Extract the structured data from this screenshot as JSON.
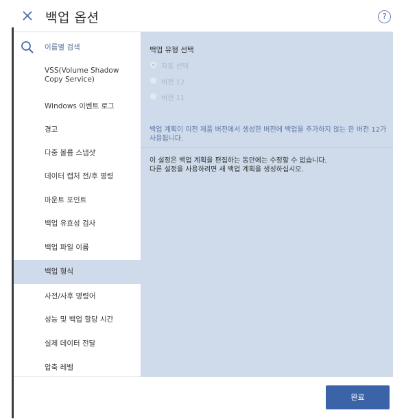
{
  "header": {
    "title": "백업 옵션",
    "help_symbol": "?"
  },
  "sidebar": {
    "search_label": "이름별 검색",
    "items": [
      {
        "label": "VSS(Volume Shadow Copy Service)"
      },
      {
        "label": "Windows 이벤트 로그"
      },
      {
        "label": "경고"
      },
      {
        "label": "다중 볼륨 스냅샷"
      },
      {
        "label": "데이터 캡처 전/후 명령"
      },
      {
        "label": "마운트 포인트"
      },
      {
        "label": "백업 유효성 검사"
      },
      {
        "label": "백업 파일 이름"
      },
      {
        "label": "백업 형식"
      },
      {
        "label": "사전/사후 명령어"
      },
      {
        "label": "성능 및 백업 할당 시간"
      },
      {
        "label": "실제 데이터 전달"
      },
      {
        "label": "압축 레벨"
      }
    ],
    "active_item": "백업 형식"
  },
  "content": {
    "section_title": "백업 유형 선택",
    "options": [
      {
        "label": "자동 선택",
        "checked": true
      },
      {
        "label": "버전 12",
        "checked": false
      },
      {
        "label": "버전 11",
        "checked": false
      }
    ],
    "info_text": "백업 계획이 이전 제품 버전에서 생성한 버전에 백업을 추가하지 않는 한 버전 12가 사용됩니다.",
    "notice_line1": "이 설정은 백업 계획을 편집하는 동안에는 수정할 수 없습니다.",
    "notice_line2": "다른 설정을 사용하려면 새 백업 계획을 생성하십시오."
  },
  "footer": {
    "done_label": "완료"
  },
  "colors": {
    "accent": "#3b63a8",
    "panel_bg": "#cfdbea",
    "info_text": "#5c76a8"
  }
}
